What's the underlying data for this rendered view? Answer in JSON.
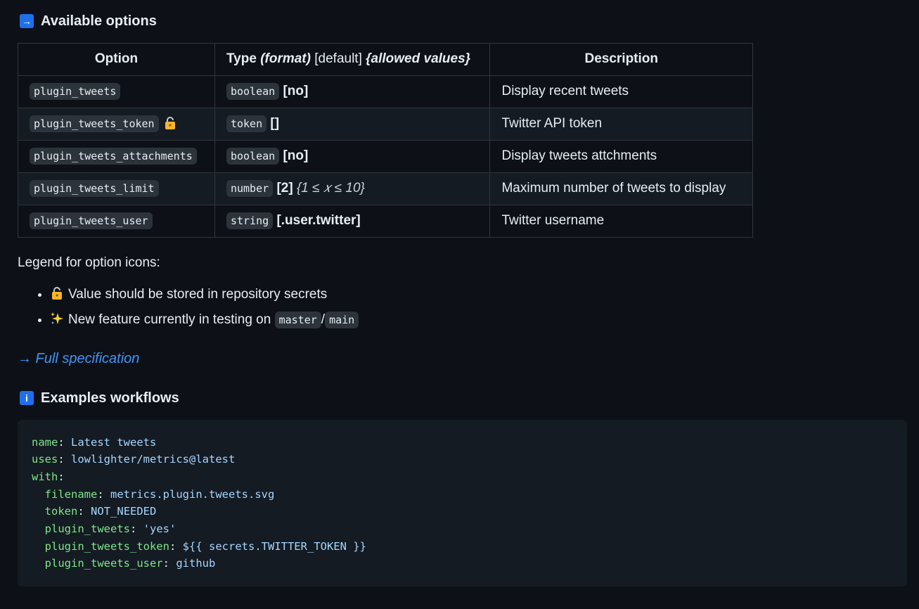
{
  "options_section": {
    "icon": "arrow-right-icon",
    "title": "Available options"
  },
  "table": {
    "headers": {
      "option": "Option",
      "type_prefix": "Type",
      "type_format": "(format)",
      "type_default": "[default]",
      "type_allowed": "{allowed values}",
      "description": "Description"
    },
    "rows": [
      {
        "option": "plugin_tweets",
        "type": "boolean",
        "default": "[no]",
        "allowed": "",
        "description": "Display recent tweets",
        "secret": false
      },
      {
        "option": "plugin_tweets_token",
        "type": "token",
        "default": "[]",
        "allowed": "",
        "description": "Twitter API token",
        "secret": true
      },
      {
        "option": "plugin_tweets_attachments",
        "type": "boolean",
        "default": "[no]",
        "allowed": "",
        "description": "Display tweets attchments",
        "secret": false
      },
      {
        "option": "plugin_tweets_limit",
        "type": "number",
        "default": "[2]",
        "allowed": "{1 ≤ 𝑥 ≤ 10}",
        "description": "Maximum number of tweets to display",
        "secret": false
      },
      {
        "option": "plugin_tweets_user",
        "type": "string",
        "default": "[.user.twitter]",
        "allowed": "",
        "description": "Twitter username",
        "secret": false
      }
    ]
  },
  "legend": {
    "title": "Legend for option icons:",
    "items": [
      {
        "icon": "lock-icon",
        "text": "Value should be stored in repository secrets"
      },
      {
        "icon": "sparkles-icon",
        "text": "New feature currently in testing on",
        "code1": "master",
        "sep": "/",
        "code2": "main"
      }
    ]
  },
  "spec_link": "→ Full specification",
  "examples_section": {
    "icon": "info-icon",
    "icon_text": "i",
    "title": "Examples workflows"
  },
  "code_block": {
    "lines": [
      {
        "indent": "",
        "key": "name",
        "value": "Latest tweets"
      },
      {
        "indent": "",
        "key": "uses",
        "value": "lowlighter/metrics@latest"
      },
      {
        "indent": "",
        "key": "with",
        "value": ""
      },
      {
        "indent": "  ",
        "key": "filename",
        "value": "metrics.plugin.tweets.svg"
      },
      {
        "indent": "  ",
        "key": "token",
        "value": "NOT_NEEDED"
      },
      {
        "indent": "  ",
        "key": "plugin_tweets",
        "value": "'yes'"
      },
      {
        "indent": "  ",
        "key": "plugin_tweets_token",
        "value": "${{ secrets.TWITTER_TOKEN }}"
      },
      {
        "indent": "  ",
        "key": "plugin_tweets_user",
        "value": "github"
      }
    ]
  },
  "colors": {
    "background": "#0d1117",
    "accent_blue": "#1f6feb",
    "link": "#4493f8",
    "yaml_key": "#7ee787",
    "yaml_value": "#a5d6ff"
  }
}
